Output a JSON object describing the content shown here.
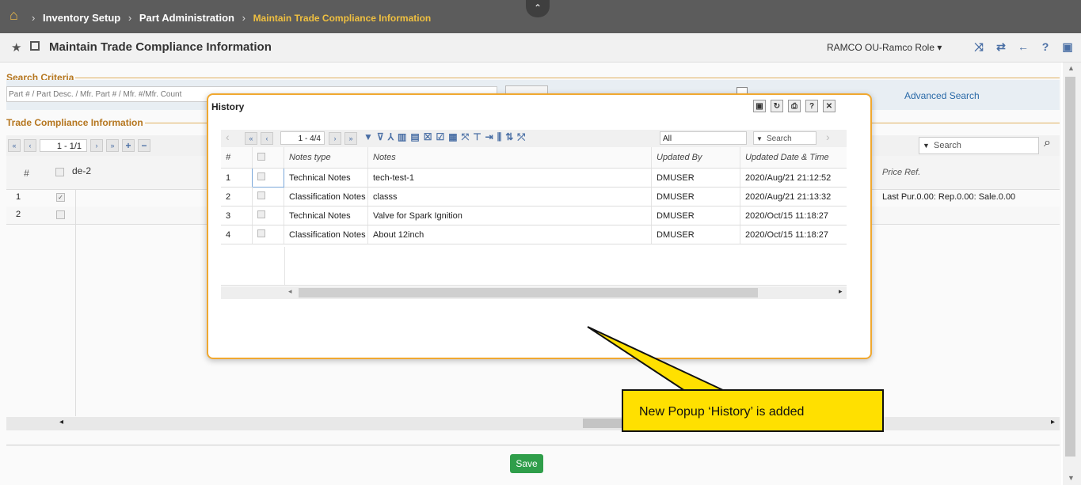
{
  "breadcrumb": {
    "items": [
      "Inventory Setup",
      "Part Administration"
    ],
    "current": "Maintain Trade Compliance Information"
  },
  "titlebar": {
    "title": "Maintain Trade Compliance Information",
    "ou_role": "RAMCO OU-Ramco Role",
    "icons": [
      "switch-icon",
      "swap-icon",
      "back-icon",
      "help-icon",
      "screen-icon",
      "minimize-icon"
    ]
  },
  "search_criteria": {
    "label": "Search Criteria",
    "placeholder": "Part # / Part Desc. / Mfr. Part # / Mfr. #/Mfr. Count",
    "advanced_search": "Advanced Search"
  },
  "trade_compliance": {
    "label": "Trade Compliance Information",
    "pager": "1 - 1/1",
    "search_placeholder": "Search",
    "columns": [
      "#",
      "de-2",
      "Price Ref."
    ],
    "rows": [
      {
        "num": "1",
        "checked": true,
        "price_ref": "Last Pur.0.00: Rep.0.00: Sale.0.00"
      },
      {
        "num": "2",
        "checked": false,
        "price_ref": ""
      }
    ]
  },
  "save_label": "Save",
  "popup": {
    "title": "History",
    "pager": "1 - 4/4",
    "filter_value": "All",
    "search_placeholder": "Search",
    "columns": [
      "#",
      "Notes type",
      "Notes",
      "Updated By",
      "Updated Date & Time"
    ],
    "rows": [
      {
        "num": "1",
        "notes_type": "Technical Notes",
        "notes": "tech-test-1",
        "updated_by": "DMUSER",
        "updated_at": "2020/Aug/21 21:12:52"
      },
      {
        "num": "2",
        "notes_type": "Classification Notes",
        "notes": "classs",
        "updated_by": "DMUSER",
        "updated_at": "2020/Aug/21 21:13:32"
      },
      {
        "num": "3",
        "notes_type": "Technical Notes",
        "notes": "Valve for Spark Ignition",
        "updated_by": "DMUSER",
        "updated_at": "2020/Oct/15 11:18:27"
      },
      {
        "num": "4",
        "notes_type": "Classification Notes",
        "notes": "About 12inch",
        "updated_by": "DMUSER",
        "updated_at": "2020/Oct/15 11:18:27"
      }
    ]
  },
  "callout": {
    "text": "New Popup ‘History’ is added",
    "color": "#ffe000"
  },
  "colors": {
    "topbar": "#5c5c5c",
    "accent": "#f0a830",
    "section_label": "#b5761f",
    "save": "#2f9e4a"
  }
}
